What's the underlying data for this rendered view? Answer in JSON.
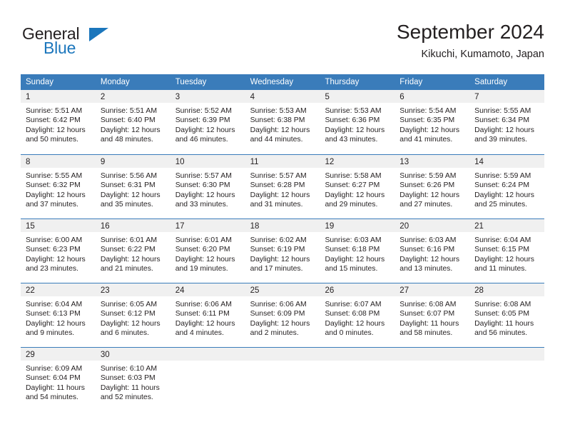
{
  "brand": {
    "name_top": "General",
    "name_bottom": "Blue",
    "triangle_color": "#1b76bc"
  },
  "header": {
    "title": "September 2024",
    "subtitle": "Kikuchi, Kumamoto, Japan"
  },
  "theme": {
    "header_blue": "#3a7cba",
    "day_band_gray": "#f0f0f0",
    "text": "#231f20"
  },
  "weekdays": [
    "Sunday",
    "Monday",
    "Tuesday",
    "Wednesday",
    "Thursday",
    "Friday",
    "Saturday"
  ],
  "weeks": [
    [
      {
        "day": "1",
        "sunrise": "Sunrise: 5:51 AM",
        "sunset": "Sunset: 6:42 PM",
        "daylight1": "Daylight: 12 hours",
        "daylight2": "and 50 minutes."
      },
      {
        "day": "2",
        "sunrise": "Sunrise: 5:51 AM",
        "sunset": "Sunset: 6:40 PM",
        "daylight1": "Daylight: 12 hours",
        "daylight2": "and 48 minutes."
      },
      {
        "day": "3",
        "sunrise": "Sunrise: 5:52 AM",
        "sunset": "Sunset: 6:39 PM",
        "daylight1": "Daylight: 12 hours",
        "daylight2": "and 46 minutes."
      },
      {
        "day": "4",
        "sunrise": "Sunrise: 5:53 AM",
        "sunset": "Sunset: 6:38 PM",
        "daylight1": "Daylight: 12 hours",
        "daylight2": "and 44 minutes."
      },
      {
        "day": "5",
        "sunrise": "Sunrise: 5:53 AM",
        "sunset": "Sunset: 6:36 PM",
        "daylight1": "Daylight: 12 hours",
        "daylight2": "and 43 minutes."
      },
      {
        "day": "6",
        "sunrise": "Sunrise: 5:54 AM",
        "sunset": "Sunset: 6:35 PM",
        "daylight1": "Daylight: 12 hours",
        "daylight2": "and 41 minutes."
      },
      {
        "day": "7",
        "sunrise": "Sunrise: 5:55 AM",
        "sunset": "Sunset: 6:34 PM",
        "daylight1": "Daylight: 12 hours",
        "daylight2": "and 39 minutes."
      }
    ],
    [
      {
        "day": "8",
        "sunrise": "Sunrise: 5:55 AM",
        "sunset": "Sunset: 6:32 PM",
        "daylight1": "Daylight: 12 hours",
        "daylight2": "and 37 minutes."
      },
      {
        "day": "9",
        "sunrise": "Sunrise: 5:56 AM",
        "sunset": "Sunset: 6:31 PM",
        "daylight1": "Daylight: 12 hours",
        "daylight2": "and 35 minutes."
      },
      {
        "day": "10",
        "sunrise": "Sunrise: 5:57 AM",
        "sunset": "Sunset: 6:30 PM",
        "daylight1": "Daylight: 12 hours",
        "daylight2": "and 33 minutes."
      },
      {
        "day": "11",
        "sunrise": "Sunrise: 5:57 AM",
        "sunset": "Sunset: 6:28 PM",
        "daylight1": "Daylight: 12 hours",
        "daylight2": "and 31 minutes."
      },
      {
        "day": "12",
        "sunrise": "Sunrise: 5:58 AM",
        "sunset": "Sunset: 6:27 PM",
        "daylight1": "Daylight: 12 hours",
        "daylight2": "and 29 minutes."
      },
      {
        "day": "13",
        "sunrise": "Sunrise: 5:59 AM",
        "sunset": "Sunset: 6:26 PM",
        "daylight1": "Daylight: 12 hours",
        "daylight2": "and 27 minutes."
      },
      {
        "day": "14",
        "sunrise": "Sunrise: 5:59 AM",
        "sunset": "Sunset: 6:24 PM",
        "daylight1": "Daylight: 12 hours",
        "daylight2": "and 25 minutes."
      }
    ],
    [
      {
        "day": "15",
        "sunrise": "Sunrise: 6:00 AM",
        "sunset": "Sunset: 6:23 PM",
        "daylight1": "Daylight: 12 hours",
        "daylight2": "and 23 minutes."
      },
      {
        "day": "16",
        "sunrise": "Sunrise: 6:01 AM",
        "sunset": "Sunset: 6:22 PM",
        "daylight1": "Daylight: 12 hours",
        "daylight2": "and 21 minutes."
      },
      {
        "day": "17",
        "sunrise": "Sunrise: 6:01 AM",
        "sunset": "Sunset: 6:20 PM",
        "daylight1": "Daylight: 12 hours",
        "daylight2": "and 19 minutes."
      },
      {
        "day": "18",
        "sunrise": "Sunrise: 6:02 AM",
        "sunset": "Sunset: 6:19 PM",
        "daylight1": "Daylight: 12 hours",
        "daylight2": "and 17 minutes."
      },
      {
        "day": "19",
        "sunrise": "Sunrise: 6:03 AM",
        "sunset": "Sunset: 6:18 PM",
        "daylight1": "Daylight: 12 hours",
        "daylight2": "and 15 minutes."
      },
      {
        "day": "20",
        "sunrise": "Sunrise: 6:03 AM",
        "sunset": "Sunset: 6:16 PM",
        "daylight1": "Daylight: 12 hours",
        "daylight2": "and 13 minutes."
      },
      {
        "day": "21",
        "sunrise": "Sunrise: 6:04 AM",
        "sunset": "Sunset: 6:15 PM",
        "daylight1": "Daylight: 12 hours",
        "daylight2": "and 11 minutes."
      }
    ],
    [
      {
        "day": "22",
        "sunrise": "Sunrise: 6:04 AM",
        "sunset": "Sunset: 6:13 PM",
        "daylight1": "Daylight: 12 hours",
        "daylight2": "and 9 minutes."
      },
      {
        "day": "23",
        "sunrise": "Sunrise: 6:05 AM",
        "sunset": "Sunset: 6:12 PM",
        "daylight1": "Daylight: 12 hours",
        "daylight2": "and 6 minutes."
      },
      {
        "day": "24",
        "sunrise": "Sunrise: 6:06 AM",
        "sunset": "Sunset: 6:11 PM",
        "daylight1": "Daylight: 12 hours",
        "daylight2": "and 4 minutes."
      },
      {
        "day": "25",
        "sunrise": "Sunrise: 6:06 AM",
        "sunset": "Sunset: 6:09 PM",
        "daylight1": "Daylight: 12 hours",
        "daylight2": "and 2 minutes."
      },
      {
        "day": "26",
        "sunrise": "Sunrise: 6:07 AM",
        "sunset": "Sunset: 6:08 PM",
        "daylight1": "Daylight: 12 hours",
        "daylight2": "and 0 minutes."
      },
      {
        "day": "27",
        "sunrise": "Sunrise: 6:08 AM",
        "sunset": "Sunset: 6:07 PM",
        "daylight1": "Daylight: 11 hours",
        "daylight2": "and 58 minutes."
      },
      {
        "day": "28",
        "sunrise": "Sunrise: 6:08 AM",
        "sunset": "Sunset: 6:05 PM",
        "daylight1": "Daylight: 11 hours",
        "daylight2": "and 56 minutes."
      }
    ],
    [
      {
        "day": "29",
        "sunrise": "Sunrise: 6:09 AM",
        "sunset": "Sunset: 6:04 PM",
        "daylight1": "Daylight: 11 hours",
        "daylight2": "and 54 minutes."
      },
      {
        "day": "30",
        "sunrise": "Sunrise: 6:10 AM",
        "sunset": "Sunset: 6:03 PM",
        "daylight1": "Daylight: 11 hours",
        "daylight2": "and 52 minutes."
      },
      {
        "day": "",
        "sunrise": "",
        "sunset": "",
        "daylight1": "",
        "daylight2": ""
      },
      {
        "day": "",
        "sunrise": "",
        "sunset": "",
        "daylight1": "",
        "daylight2": ""
      },
      {
        "day": "",
        "sunrise": "",
        "sunset": "",
        "daylight1": "",
        "daylight2": ""
      },
      {
        "day": "",
        "sunrise": "",
        "sunset": "",
        "daylight1": "",
        "daylight2": ""
      },
      {
        "day": "",
        "sunrise": "",
        "sunset": "",
        "daylight1": "",
        "daylight2": ""
      }
    ]
  ]
}
